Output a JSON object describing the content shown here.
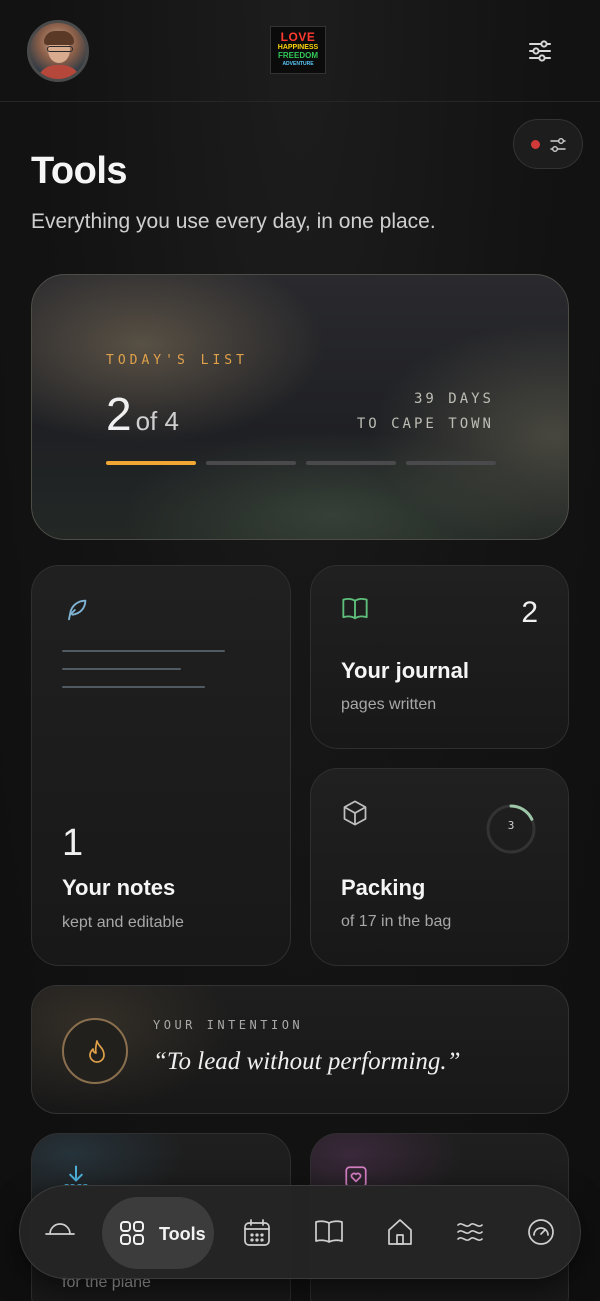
{
  "header": {
    "logo": {
      "line1": "LOVE",
      "line2": "HAPPINESS",
      "line3": "FREEDOM",
      "line4": "ADVENTURE"
    }
  },
  "page": {
    "title": "Tools",
    "subtitle": "Everything you use every day, in one place."
  },
  "today_list": {
    "eyebrow": "TODAY'S LIST",
    "done": "2",
    "total_label": "of 4",
    "countdown_line1": "39 DAYS",
    "countdown_line2": "TO CAPE TOWN",
    "progress_fraction": 0.5
  },
  "notes": {
    "count": "1",
    "title": "Your notes",
    "subtitle": "kept and editable"
  },
  "journal": {
    "count": "2",
    "title": "Your journal",
    "subtitle": "pages written"
  },
  "packing": {
    "ring_value": "3",
    "title": "Packing",
    "subtitle": "of 17 in the bag",
    "fraction": 0.18
  },
  "intention": {
    "eyebrow": "YOUR INTENTION",
    "quote": "“To lead without performing.”"
  },
  "partial_cards": {
    "left_subtitle": "for the plane"
  },
  "nav": {
    "active_label": "Tools"
  },
  "colors": {
    "accent": "#f0a733",
    "alert_dot": "#d23a3a",
    "journal_icon": "#5fbf7a",
    "notes_icon": "#7fb4d6"
  }
}
